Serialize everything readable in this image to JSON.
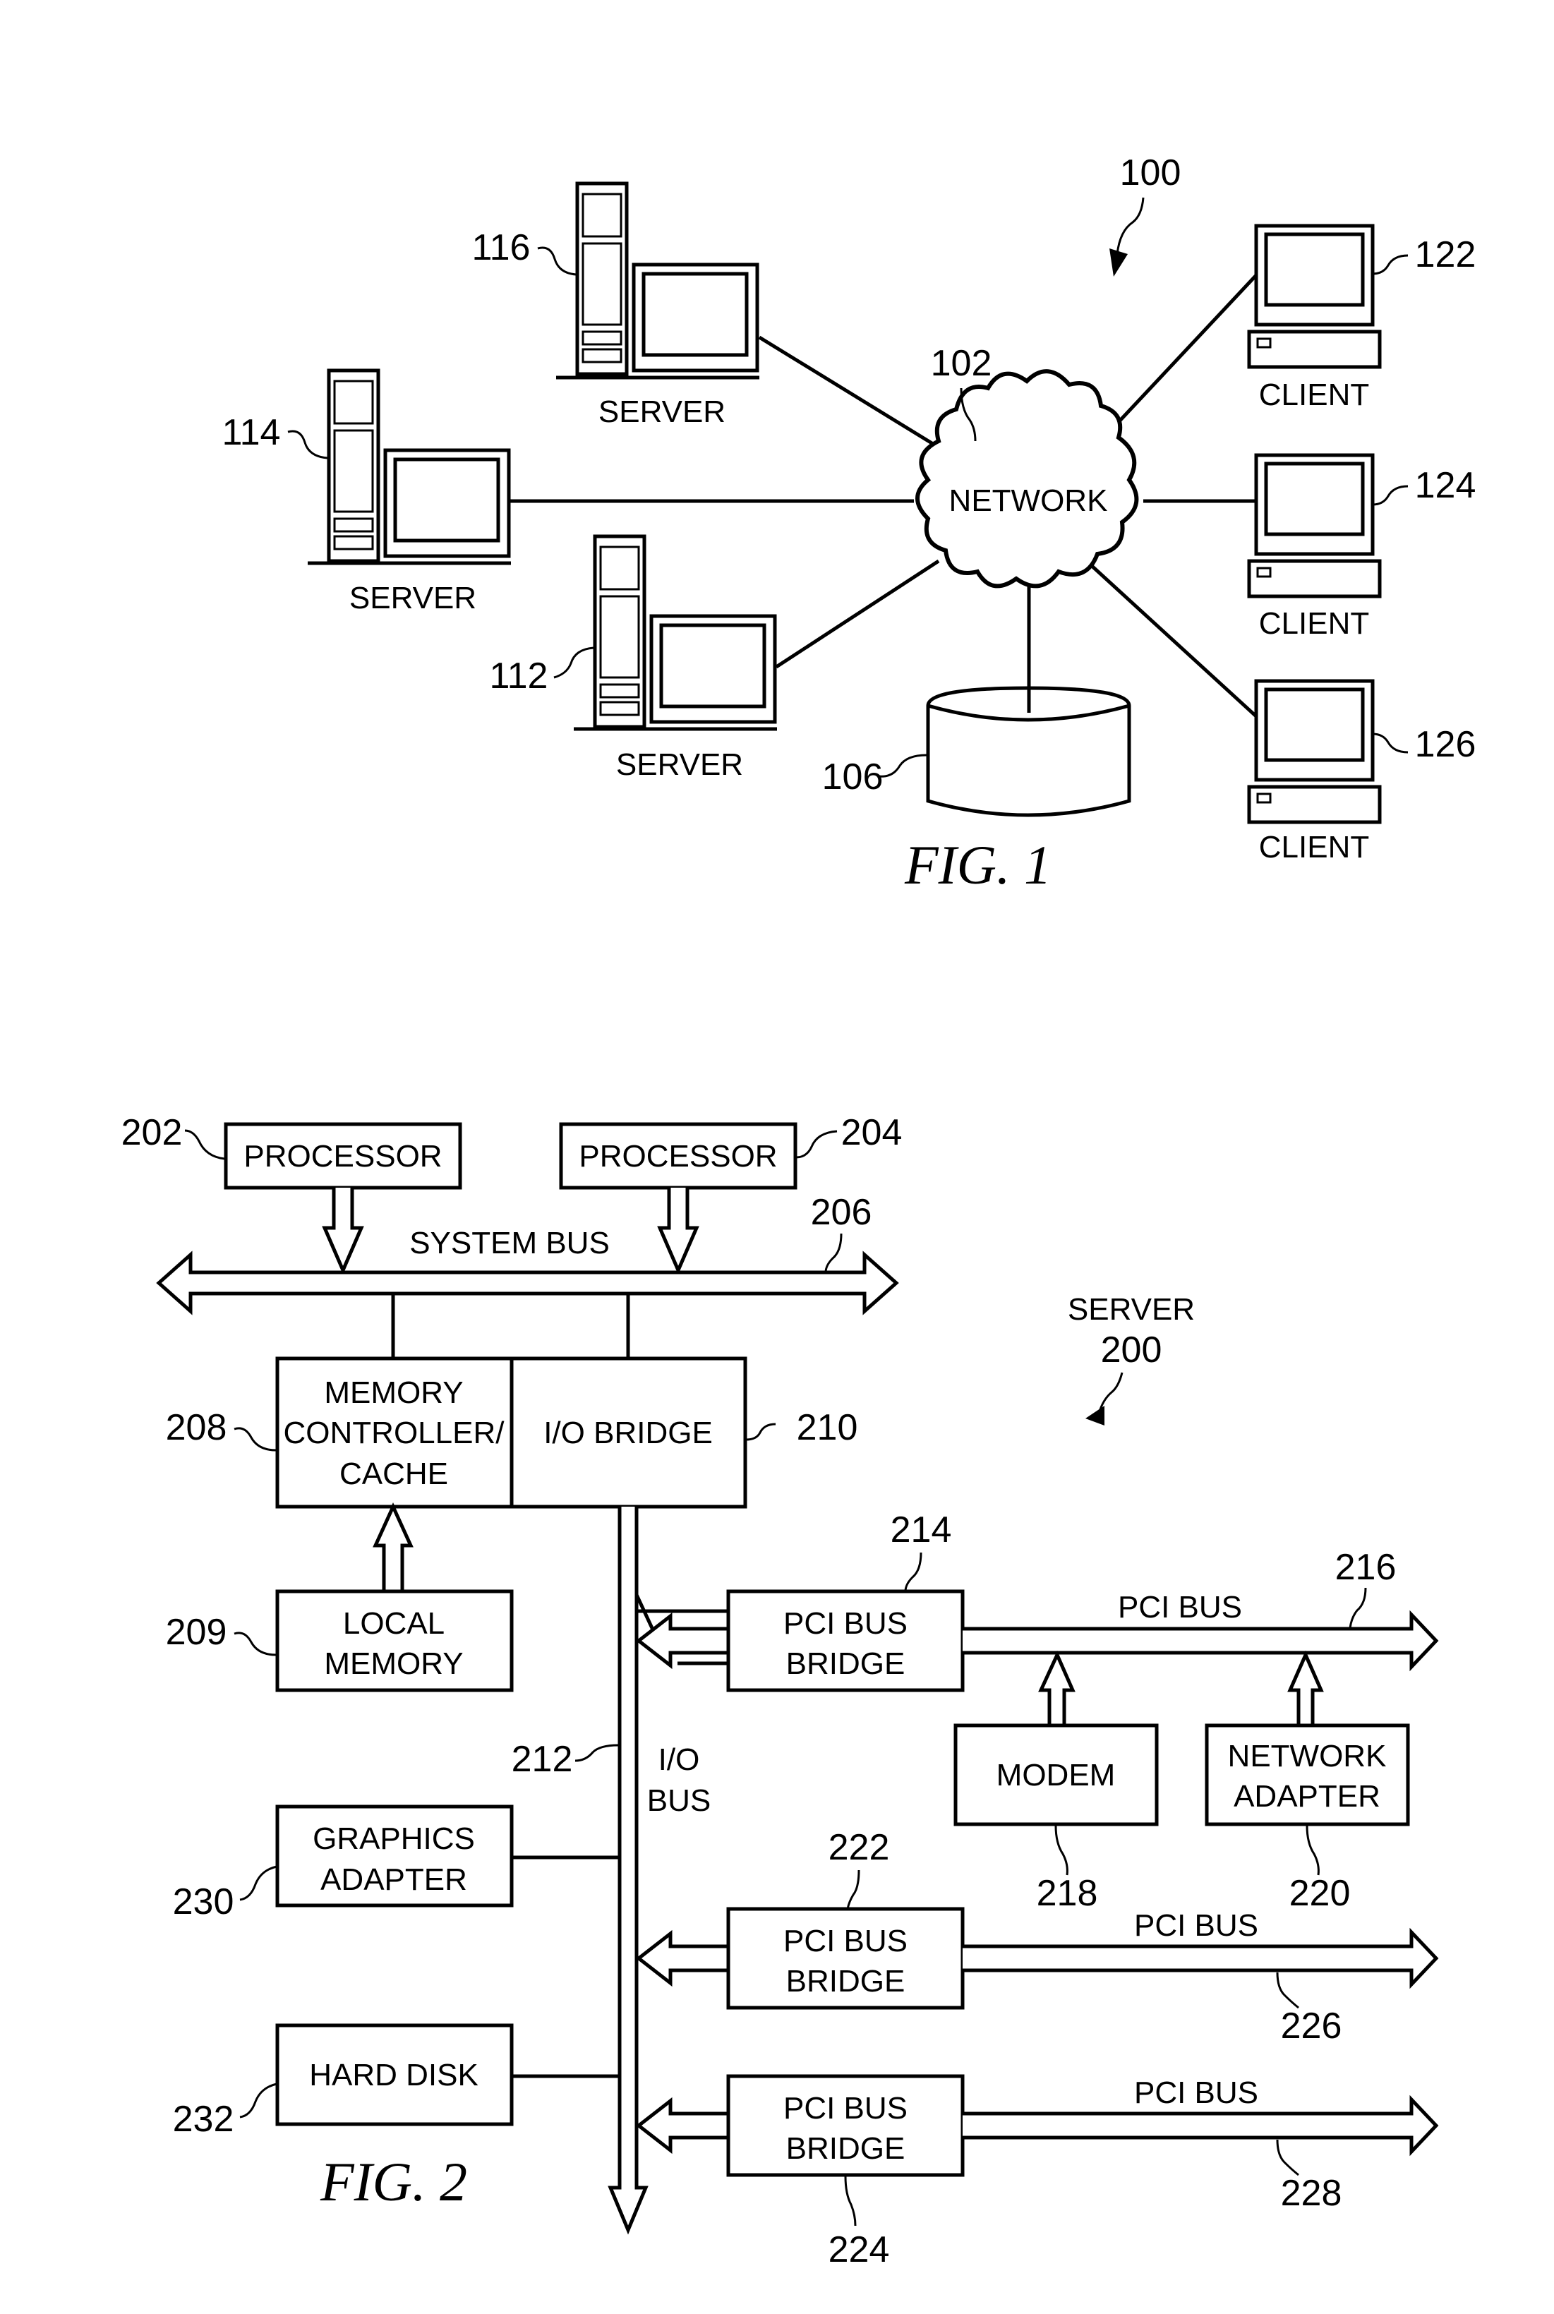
{
  "fig1": {
    "caption": "FIG. 1",
    "system_ref": "100",
    "network": {
      "label": "NETWORK",
      "ref": "102"
    },
    "storage": {
      "ref": "106"
    },
    "servers": [
      {
        "label": "SERVER",
        "ref": "116"
      },
      {
        "label": "SERVER",
        "ref": "114"
      },
      {
        "label": "SERVER",
        "ref": "112"
      }
    ],
    "clients": [
      {
        "label": "CLIENT",
        "ref": "122"
      },
      {
        "label": "CLIENT",
        "ref": "124"
      },
      {
        "label": "CLIENT",
        "ref": "126"
      }
    ]
  },
  "fig2": {
    "caption": "FIG. 2",
    "server_label": "SERVER",
    "server_ref": "200",
    "processors": [
      {
        "label": "PROCESSOR",
        "ref": "202"
      },
      {
        "label": "PROCESSOR",
        "ref": "204"
      }
    ],
    "system_bus": {
      "label": "SYSTEM BUS",
      "ref": "206"
    },
    "memory_controller": {
      "lines": [
        "MEMORY",
        "CONTROLLER/",
        "CACHE"
      ],
      "ref": "208"
    },
    "io_bridge": {
      "label": "I/O BRIDGE",
      "ref": "210"
    },
    "local_memory": {
      "lines": [
        "LOCAL",
        "MEMORY"
      ],
      "ref": "209"
    },
    "io_bus": {
      "lines": [
        "I/O",
        "BUS"
      ],
      "ref": "212"
    },
    "pci_bridges": [
      {
        "lines": [
          "PCI BUS",
          "BRIDGE"
        ],
        "ref": "214",
        "bus_label": "PCI BUS",
        "bus_ref": "216"
      },
      {
        "lines": [
          "PCI BUS",
          "BRIDGE"
        ],
        "ref": "222",
        "bus_label": "PCI BUS",
        "bus_ref": "226"
      },
      {
        "lines": [
          "PCI BUS",
          "BRIDGE"
        ],
        "ref": "224",
        "bus_label": "PCI BUS",
        "bus_ref": "228"
      }
    ],
    "modem": {
      "label": "MODEM",
      "ref": "218"
    },
    "network_adapter": {
      "lines": [
        "NETWORK",
        "ADAPTER"
      ],
      "ref": "220"
    },
    "graphics_adapter": {
      "lines": [
        "GRAPHICS",
        "ADAPTER"
      ],
      "ref": "230"
    },
    "hard_disk": {
      "label": "HARD DISK",
      "ref": "232"
    }
  }
}
